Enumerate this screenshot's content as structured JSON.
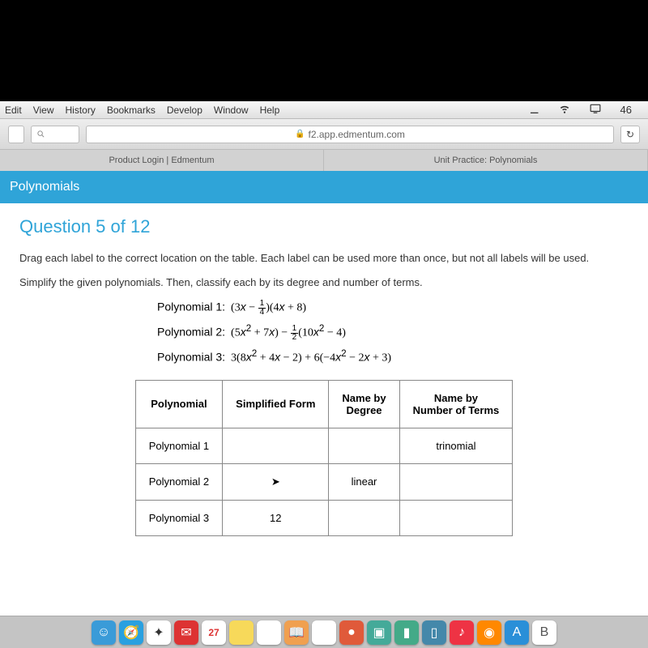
{
  "menubar": {
    "items": [
      "Edit",
      "View",
      "History",
      "Bookmarks",
      "Develop",
      "Window",
      "Help"
    ],
    "battery": "46"
  },
  "toolbar": {
    "url": "f2.app.edmentum.com",
    "search_placeholder": ""
  },
  "tabs": {
    "left": "Product Login | Edmentum",
    "right": "Unit Practice: Polynomials"
  },
  "banner": {
    "title": "Polynomials"
  },
  "question": {
    "heading": "Question 5 of 12",
    "instr1": "Drag each label to the correct location on the table. Each label can be used more than once, but not all labels will be used.",
    "instr2": "Simplify the given polynomials. Then, classify each by its degree and number of terms.",
    "poly_labels": {
      "p1": "Polynomial 1:",
      "p2": "Polynomial 2:",
      "p3": "Polynomial 3:"
    }
  },
  "table": {
    "headers": [
      "Polynomial",
      "Simplified Form",
      "Name by\nDegree",
      "Name by\nNumber of Terms"
    ],
    "rows": [
      {
        "label": "Polynomial 1",
        "simplified": "",
        "degree": "",
        "terms": "trinomial"
      },
      {
        "label": "Polynomial 2",
        "simplified": "",
        "degree": "linear",
        "terms": ""
      },
      {
        "label": "Polynomial 3",
        "simplified": "12",
        "degree": "",
        "terms": ""
      }
    ]
  },
  "dock": {
    "date": "27",
    "icons": [
      {
        "name": "finder",
        "bg": "#3a9bd8"
      },
      {
        "name": "safari",
        "bg": "#29a0e0"
      },
      {
        "name": "compass",
        "bg": "#fff"
      },
      {
        "name": "mail",
        "bg": "#d33"
      },
      {
        "name": "calendar",
        "bg": "#fff"
      },
      {
        "name": "notes",
        "bg": "#f7d95a"
      },
      {
        "name": "reminders",
        "bg": "#fff"
      },
      {
        "name": "messages",
        "bg": "#f0a050"
      },
      {
        "name": "photos",
        "bg": "#fff"
      },
      {
        "name": "chrome",
        "bg": "#e05a3a"
      },
      {
        "name": "preview",
        "bg": "#4a9"
      },
      {
        "name": "pages",
        "bg": "#4a8"
      },
      {
        "name": "numbers",
        "bg": "#48a"
      },
      {
        "name": "music",
        "bg": "#e34"
      },
      {
        "name": "app1",
        "bg": "#f80"
      },
      {
        "name": "appstore",
        "bg": "#2a8fd8"
      },
      {
        "name": "app2",
        "bg": "#fff"
      }
    ]
  }
}
